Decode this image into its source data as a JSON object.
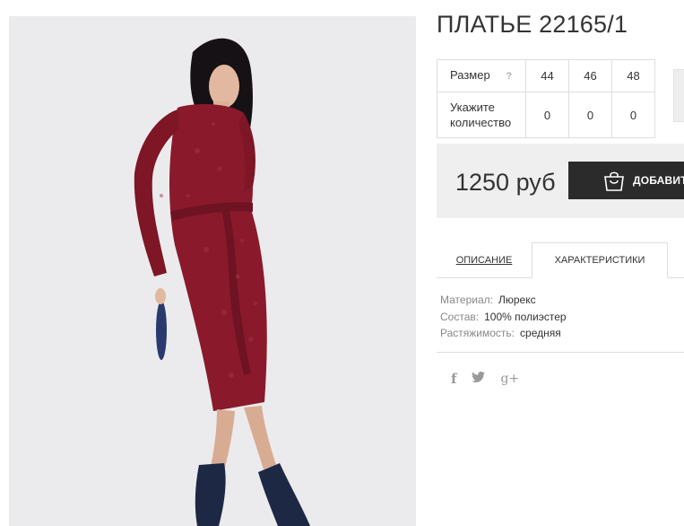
{
  "product": {
    "title": "ПЛАТЬЕ 22165/1",
    "image_alt": "Model in burgundy lurex midi dress"
  },
  "size_table": {
    "size_label": "Размер",
    "help_icon": "?",
    "sizes": [
      "44",
      "46",
      "48"
    ],
    "qty_label": "Укажите количество",
    "quantities": [
      "0",
      "0",
      "0"
    ]
  },
  "purchase": {
    "price": "1250 руб",
    "add_button_label": "ДОБАВИТЬ",
    "button_icon": "shopping-bag-icon"
  },
  "tabs": {
    "description": "ОПИСАНИЕ",
    "characteristics": "ХАРАКТЕРИСТИКИ",
    "active": "characteristics"
  },
  "specs": [
    {
      "key": "Материал:",
      "value": "Люрекс"
    },
    {
      "key": "Состав:",
      "value": "100% полиэстер"
    },
    {
      "key": "Растяжимость:",
      "value": "средняя"
    }
  ],
  "social": {
    "facebook": "f",
    "twitter": "t",
    "googleplus": "g+"
  },
  "colors": {
    "dress": "#8a1a2b",
    "button_bg": "#2b2b2b",
    "panel_bg": "#efefef"
  }
}
